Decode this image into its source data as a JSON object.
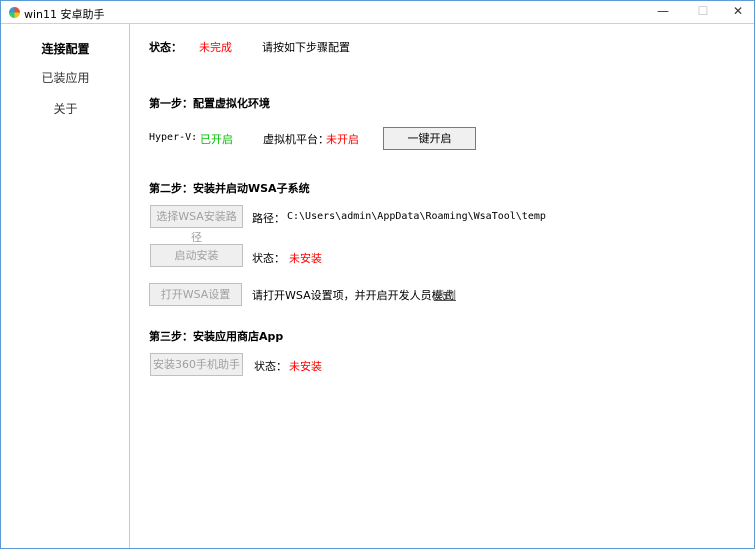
{
  "window": {
    "title": "win11 安卓助手",
    "minimize": "—",
    "maximize": "☐",
    "close": "✕"
  },
  "sidebar": {
    "items": [
      {
        "label": "连接配置"
      },
      {
        "label": "已装应用"
      },
      {
        "label": "关于"
      }
    ]
  },
  "status": {
    "label": "状态：",
    "value": "未完成",
    "hint": "请按如下步骤配置"
  },
  "step1": {
    "title": "第一步：配置虚拟化环境",
    "hyperv_label": "Hyper-V:",
    "hyperv_value": "已开启",
    "vm_label": "虚拟机平台：",
    "vm_value": "未开启",
    "button": "一键开启"
  },
  "step2": {
    "title": "第二步：安装并启动WSA子系统",
    "select_button": "选择WSA安装路径",
    "path_label": "路径：",
    "path_value": "C:\\Users\\admin\\AppData\\Roaming\\WsaTool\\temp",
    "install_button": "启动安装",
    "status_label": "状态：",
    "status_value": "未安装",
    "settings_button": "打开WSA设置",
    "settings_hint": "请打开WSA设置项，并开启开发人员模式",
    "example_link": "示例"
  },
  "step3": {
    "title": "第三步：安装应用商店App",
    "install_button": "安装360手机助手",
    "status_label": "状态：",
    "status_value": "未安装"
  }
}
